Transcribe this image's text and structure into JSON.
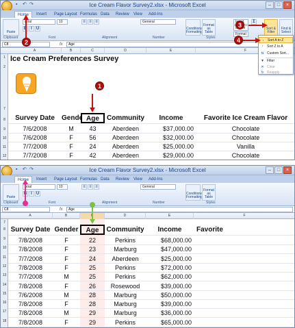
{
  "app": {
    "title": "Ice Cream Flavor Survey2.xlsx - Microsoft Excel",
    "tabs": [
      "Home",
      "Insert",
      "Page Layout",
      "Formulas",
      "Data",
      "Review",
      "View",
      "Add-Ins"
    ]
  },
  "ribbon": {
    "paste_label": "Paste",
    "font_name": "Arial",
    "font_size": "10",
    "number_format": "General",
    "group_labels": [
      "Clipboard",
      "Font",
      "Alignment",
      "Number",
      "Styles",
      "Cells",
      "Editing"
    ],
    "conditional_formatting": "Conditional Formatting",
    "format_as_table": "Format as Table",
    "cell_styles": "Cell Styles",
    "insert_btn": "Insert",
    "delete_btn": "Delete",
    "format_btn": "Format",
    "sort_filter": "Sort & Filter",
    "find_select": "Find & Select",
    "sum_symbol": "Σ"
  },
  "sort_menu": {
    "items": [
      "Sort A to Z",
      "Sort Z to A",
      "Custom Sort...",
      "Filter",
      "Clear",
      "Reapply"
    ]
  },
  "formula_bar": {
    "panel1_cell": "C8",
    "panel2_cell": "C8",
    "fx": "fx",
    "content": "Age"
  },
  "columns": [
    "A",
    "B",
    "C",
    "D",
    "E",
    "F"
  ],
  "callouts": [
    "1",
    "2",
    "3",
    "4"
  ],
  "panel1": {
    "title_text": "Ice Cream Preferences Survey",
    "row_numbers": [
      "1",
      "2",
      "3",
      "4",
      "5",
      "6",
      "7",
      "8",
      "9",
      "10",
      "11",
      "12"
    ],
    "headers": [
      "Survey Date",
      "Gender",
      "Age",
      "Community",
      "Income",
      "Favorite Ice Cream Flavor"
    ],
    "rows": [
      [
        "7/6/2008",
        "M",
        "43",
        "Aberdeen",
        "$37,000.00",
        "Chocolate"
      ],
      [
        "7/6/2008",
        "F",
        "56",
        "Aberdeen",
        "$32,000.00",
        "Chocolate"
      ],
      [
        "7/7/2008",
        "F",
        "24",
        "Aberdeen",
        "$25,000.00",
        "Vanilla"
      ],
      [
        "7/7/2008",
        "F",
        "42",
        "Aberdeen",
        "$29,000.00",
        "Chocolate"
      ]
    ]
  },
  "panel2": {
    "row_numbers": [
      "7",
      "8",
      "9",
      "10",
      "11",
      "12",
      "13",
      "14",
      "15",
      "16",
      "17",
      "18",
      "19"
    ],
    "headers": [
      "Survey Date",
      "Gender",
      "Age",
      "Community",
      "Income",
      "Favorite"
    ],
    "rows": [
      [
        "7/8/2008",
        "F",
        "22",
        "Perkins",
        "$68,000.00"
      ],
      [
        "7/8/2008",
        "F",
        "23",
        "Marburg",
        "$47,000.00"
      ],
      [
        "7/7/2008",
        "F",
        "24",
        "Aberdeen",
        "$25,000.00"
      ],
      [
        "7/8/2008",
        "F",
        "25",
        "Perkins",
        "$72,000.00"
      ],
      [
        "7/7/2008",
        "M",
        "25",
        "Perkins",
        "$62,000.00"
      ],
      [
        "7/8/2008",
        "F",
        "26",
        "Rosewood",
        "$39,000.00"
      ],
      [
        "7/6/2008",
        "M",
        "28",
        "Marburg",
        "$50,000.00"
      ],
      [
        "7/8/2008",
        "F",
        "28",
        "Marburg",
        "$39,000.00"
      ],
      [
        "7/8/2008",
        "M",
        "29",
        "Marburg",
        "$36,000.00"
      ],
      [
        "7/8/2008",
        "F",
        "29",
        "Perkins",
        "$65,000.00"
      ]
    ]
  },
  "colors": {
    "callout": "#b00d0d",
    "arrow": "#cc1111",
    "green_arrow": "#7cc142",
    "pink_marker": "#e0338f",
    "ribbon_blue": "#15428b"
  }
}
